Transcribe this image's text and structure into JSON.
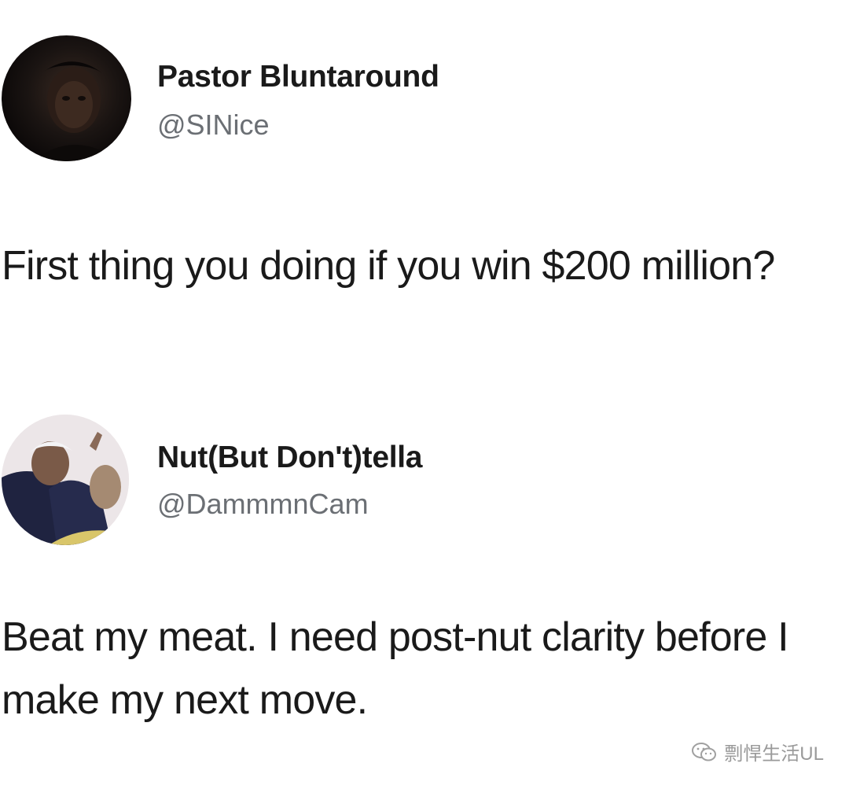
{
  "tweets": [
    {
      "author": {
        "name": "Pastor Bluntaround",
        "handle": "@SINice"
      },
      "text": "First thing you doing if you win $200 million?"
    },
    {
      "author": {
        "name": "Nut(But Don't)tella",
        "handle": "@DammmnCam"
      },
      "text": "Beat my meat. I need post-nut clarity before I make my next move."
    }
  ],
  "watermark": {
    "icon": "wechat-icon",
    "label": "剽悍生活UL"
  }
}
